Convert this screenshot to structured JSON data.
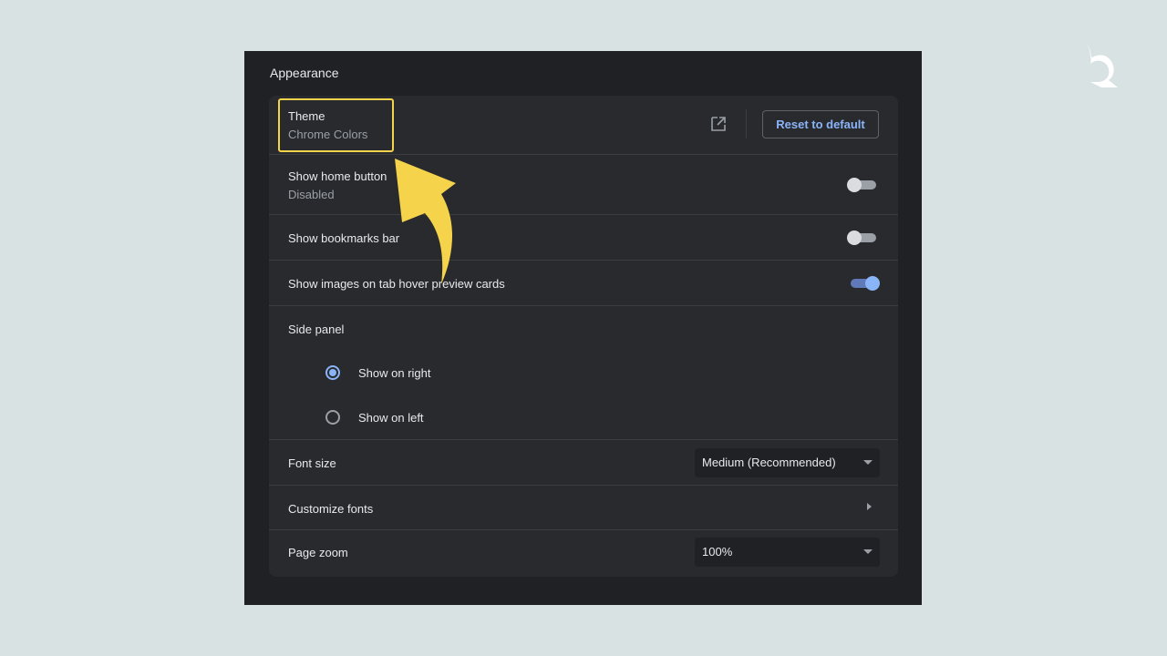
{
  "section": {
    "title": "Appearance"
  },
  "theme": {
    "label": "Theme",
    "value": "Chrome Colors",
    "open_icon": "open-in-new-icon",
    "reset_label": "Reset to default"
  },
  "home_button": {
    "label": "Show home button",
    "sublabel": "Disabled",
    "enabled": false
  },
  "bookmarks_bar": {
    "label": "Show bookmarks bar",
    "enabled": false
  },
  "tab_hover_images": {
    "label": "Show images on tab hover preview cards",
    "enabled": true
  },
  "side_panel": {
    "label": "Side panel",
    "options": [
      {
        "label": "Show on right",
        "checked": true
      },
      {
        "label": "Show on left",
        "checked": false
      }
    ]
  },
  "font_size": {
    "label": "Font size",
    "selected": "Medium (Recommended)"
  },
  "customize_fonts": {
    "label": "Customize fonts"
  },
  "page_zoom": {
    "label": "Page zoom",
    "selected": "100%"
  },
  "colors": {
    "accent": "#8ab4f8",
    "highlight": "#f5d34a",
    "background": "#d8e2e2",
    "panel": "#292a2d"
  }
}
